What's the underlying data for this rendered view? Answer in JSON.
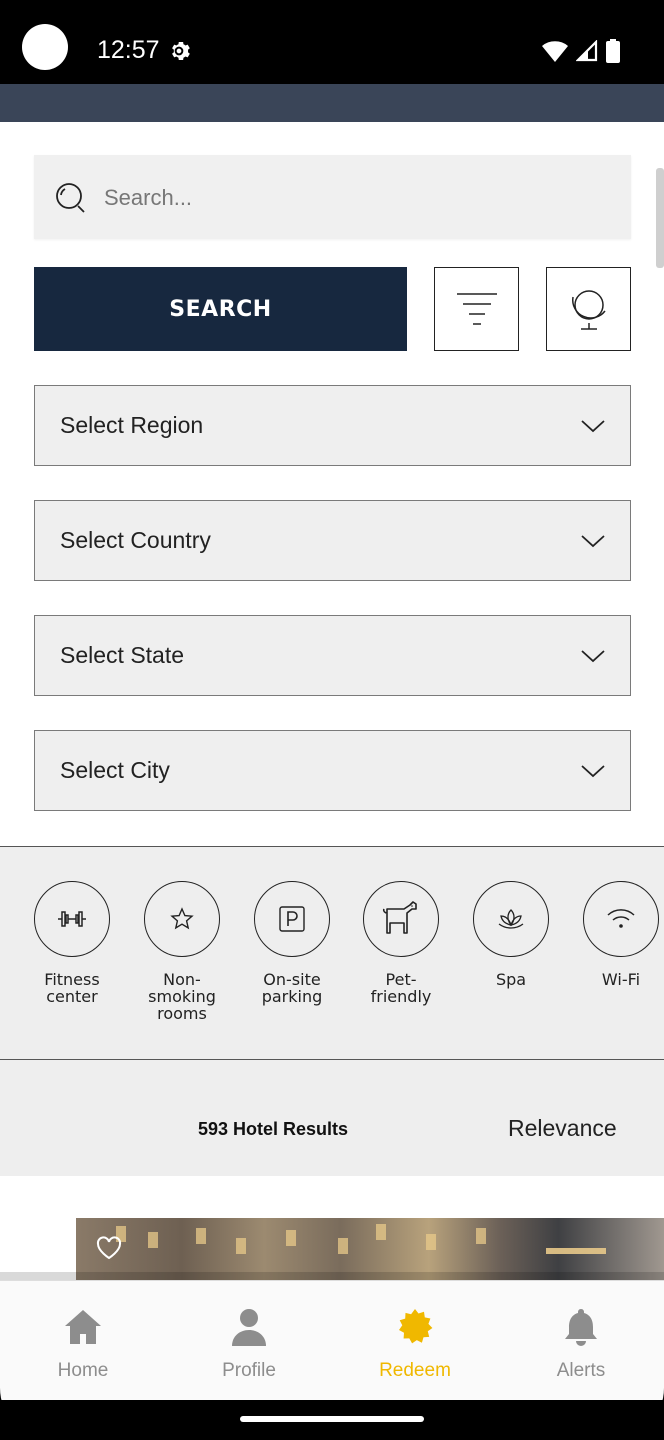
{
  "status_bar": {
    "time": "12:57"
  },
  "search": {
    "placeholder": "Search...",
    "button_label": "SEARCH"
  },
  "selects": [
    {
      "label": "Select Region"
    },
    {
      "label": "Select Country"
    },
    {
      "label": "Select State"
    },
    {
      "label": "Select City"
    }
  ],
  "amenities": [
    {
      "label": "Fitness\ncenter",
      "icon": "dumbbell-icon"
    },
    {
      "label": "Non-\nsmoking\nrooms",
      "icon": "star-icon"
    },
    {
      "label": "On-site\nparking",
      "icon": "parking-icon"
    },
    {
      "label": "Pet-\nfriendly",
      "icon": "dog-icon"
    },
    {
      "label": "Spa",
      "icon": "lotus-icon"
    },
    {
      "label": "Wi-Fi",
      "icon": "wifi-icon"
    }
  ],
  "results": {
    "count_label": "593 Hotel Results",
    "sort_label": "Relevance"
  },
  "bottom_nav": [
    {
      "label": "Home",
      "icon": "home-icon",
      "active": false
    },
    {
      "label": "Profile",
      "icon": "profile-icon",
      "active": false
    },
    {
      "label": "Redeem",
      "icon": "redeem-icon",
      "active": true
    },
    {
      "label": "Alerts",
      "icon": "bell-icon",
      "active": false
    }
  ],
  "colors": {
    "primary": "#17283f",
    "header": "#3a4558",
    "accent": "#f0b800",
    "nav_inactive": "#8d8d8d"
  }
}
